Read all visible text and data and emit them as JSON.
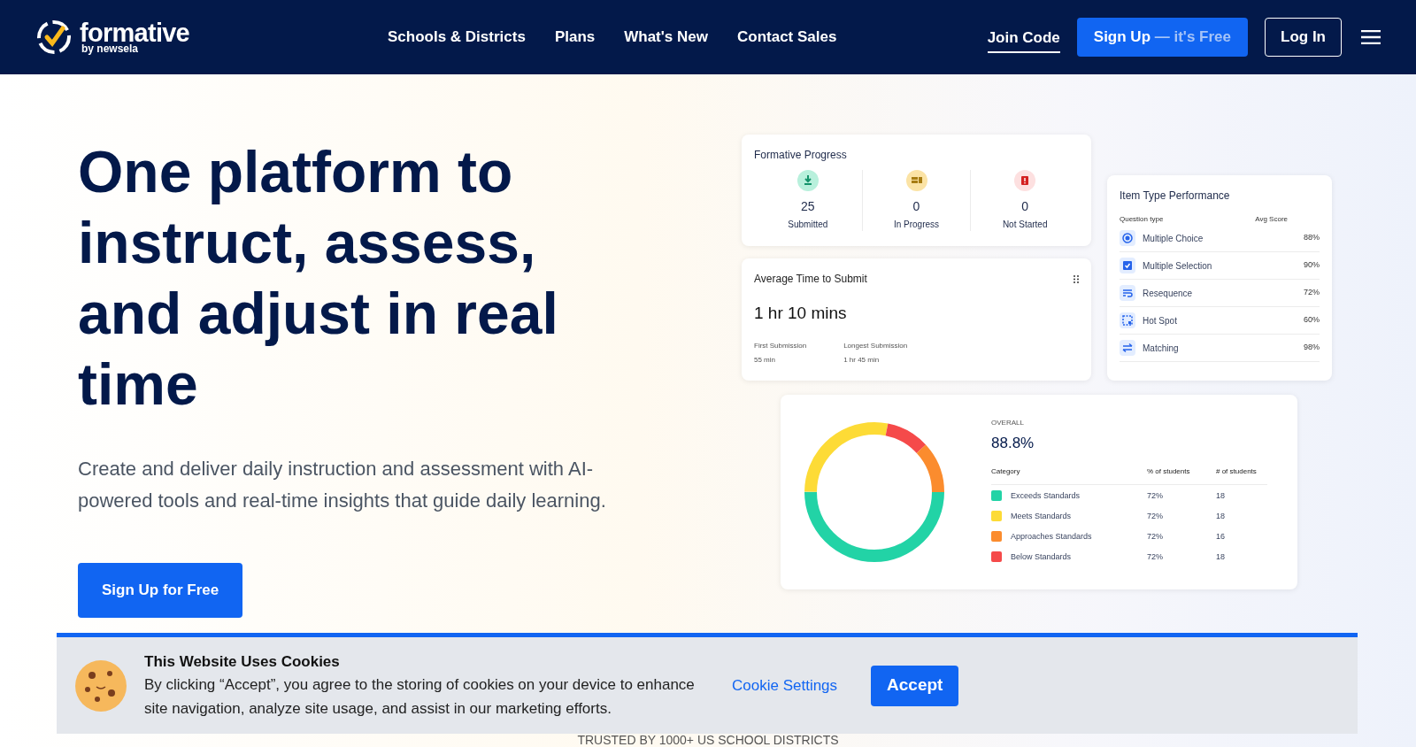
{
  "header": {
    "logo": {
      "name": "formative",
      "tagline": "by newsela"
    },
    "nav": [
      "Schools & Districts",
      "Plans",
      "What's New",
      "Contact Sales"
    ],
    "join_code": "Join Code",
    "signup": {
      "label": "Sign Up",
      "suffix": "— it's Free"
    },
    "login": "Log In"
  },
  "hero": {
    "headline": "One platform to instruct, assess, and adjust in real time",
    "subtitle": "Create and deliver daily instruction and assessment with AI-powered tools and real-time insights that guide daily learning.",
    "cta": "Sign Up for Free"
  },
  "progress_card": {
    "title": "Formative Progress",
    "stats": [
      {
        "kind": "submitted",
        "value": "25",
        "label": "Submitted"
      },
      {
        "kind": "in_progress",
        "value": "0",
        "label": "In Progress"
      },
      {
        "kind": "not_started",
        "value": "0",
        "label": "Not Started"
      }
    ]
  },
  "time_card": {
    "title": "Average Time to Submit",
    "value": "1 hr 10 mins",
    "details": [
      {
        "label": "First Submission",
        "value": "55 min"
      },
      {
        "label": "Longest Submission",
        "value": "1 hr 45 min"
      }
    ]
  },
  "item_card": {
    "title": "Item Type Performance",
    "columns": [
      "Question type",
      "Avg Score"
    ],
    "rows": [
      {
        "kind": "radio",
        "name": "Multiple Choice",
        "score": "88%"
      },
      {
        "kind": "checkbox",
        "name": "Multiple Selection",
        "score": "90%"
      },
      {
        "kind": "resequence",
        "name": "Resequence",
        "score": "72%"
      },
      {
        "kind": "hotspot",
        "name": "Hot Spot",
        "score": "60%"
      },
      {
        "kind": "matching",
        "name": "Matching",
        "score": "98%"
      }
    ]
  },
  "standards_card": {
    "overall_label": "OVERALL",
    "overall": "88.8%",
    "columns": [
      "Category",
      "% of students",
      "# of students"
    ],
    "rows": [
      {
        "name": "Exceeds Standards",
        "color": "#22d3a6",
        "percent": "72%",
        "count": "18"
      },
      {
        "name": "Meets Standards",
        "color": "#fddb36",
        "percent": "72%",
        "count": "18"
      },
      {
        "name": "Approaches Standards",
        "color": "#fb8c2e",
        "percent": "72%",
        "count": "16"
      },
      {
        "name": "Below Standards",
        "color": "#f54a4a",
        "percent": "72%",
        "count": "18"
      }
    ]
  },
  "cookie_banner": {
    "title": "This Website Uses Cookies",
    "text": "By clicking “Accept”, you agree to the storing of cookies on your device to enhance site navigation, analyze site usage, and assist in our marketing efforts.",
    "settings": "Cookie Settings",
    "accept": "Accept"
  },
  "trusted": "TRUSTED BY 1000+ US SCHOOL DISTRICTS"
}
